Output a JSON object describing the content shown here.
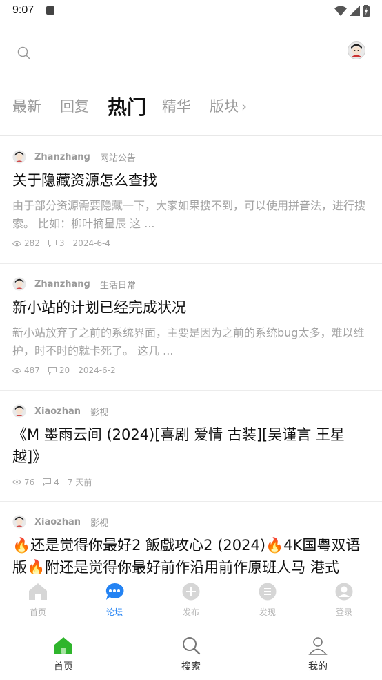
{
  "status": {
    "time": "9:07"
  },
  "tabs": [
    {
      "label": "最新"
    },
    {
      "label": "回复"
    },
    {
      "label": "热门"
    },
    {
      "label": "精华"
    },
    {
      "label": "版块"
    }
  ],
  "posts": [
    {
      "user": "Zhanzhang",
      "category": "网站公告",
      "title": "关于隐藏资源怎么查找",
      "excerpt": "由于部分资源需要隐藏一下，大家如果搜不到，可以使用拼音法，进行搜索。 比如：柳叶摘星辰 这 ...",
      "views": "282",
      "replies": "3",
      "date": "2024-6-4"
    },
    {
      "user": "Zhanzhang",
      "category": "生活日常",
      "title": "新小站的计划已经完成状况",
      "excerpt": "新小站放弃了之前的系统界面，主要是因为之前的系统bug太多，难以维护，时不时的就卡死了。 这几 ...",
      "views": "487",
      "replies": "20",
      "date": "2024-6-2"
    },
    {
      "user": "Xiaozhan",
      "category": "影视",
      "title": "《M 墨雨云间 (2024)[喜剧 爱情 古装][吴谨言 王星越]》",
      "excerpt": "",
      "views": "76",
      "replies": "4",
      "date": "7 天前"
    },
    {
      "user": "Xiaozhan",
      "category": "影视",
      "title": "🔥还是觉得你最好2 飯戲攻心2 (2024)🔥4K国粤双语版🔥附还是觉得你最好前作沿用前作原班人马 港式",
      "excerpt": "",
      "views": "",
      "replies": "",
      "date": ""
    }
  ],
  "forum_nav": [
    {
      "label": "首页",
      "icon": "home-icon"
    },
    {
      "label": "论坛",
      "icon": "chat-bubble-icon"
    },
    {
      "label": "发布",
      "icon": "plus-circle-icon"
    },
    {
      "label": "发现",
      "icon": "list-circle-icon"
    },
    {
      "label": "登录",
      "icon": "user-circle-icon"
    }
  ],
  "app_nav": [
    {
      "label": "首页",
      "icon": "home-icon"
    },
    {
      "label": "搜索",
      "icon": "search-icon"
    },
    {
      "label": "我的",
      "icon": "person-icon"
    }
  ],
  "colors": {
    "accent_blue": "#2483f3",
    "home_green": "#2fb52c",
    "muted_gray": "#a3a3a3"
  }
}
